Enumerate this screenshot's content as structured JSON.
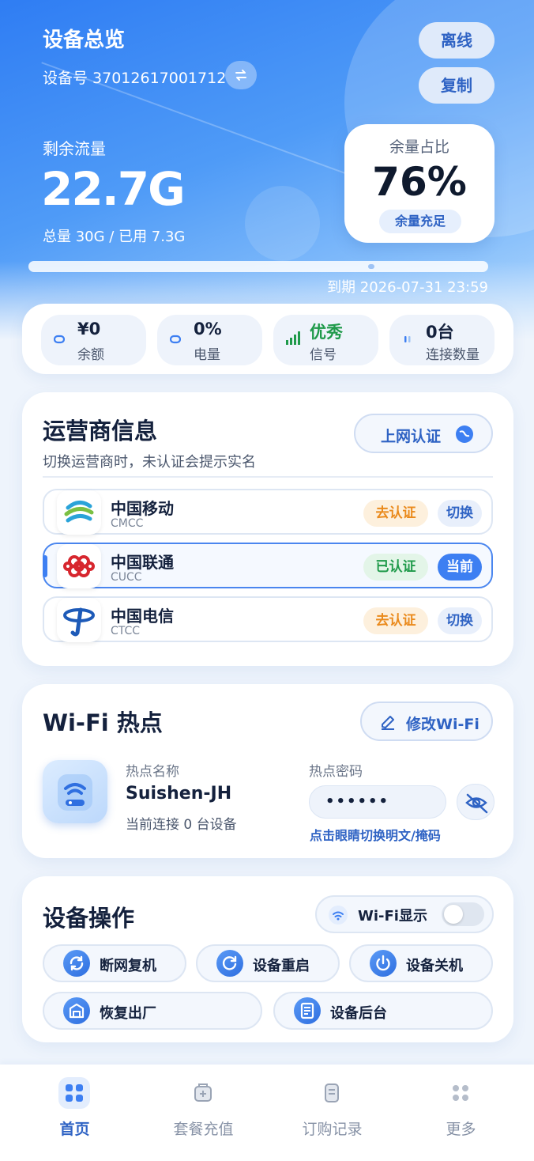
{
  "header": {
    "title": "设备总览",
    "device_no_label": "设备号 37012617001712",
    "offline_label": "离线",
    "copy_label": "复制",
    "remain_label": "剩余流量",
    "remain_value": "22.7G",
    "usage_line": "总量 30G / 已用 7.3G",
    "ratio_label": "余量占比",
    "ratio_value": "76%",
    "ratio_badge": "余量充足",
    "expire_text": "到期 2026-07-31 23:59"
  },
  "stats": [
    {
      "value": "¥0",
      "label": "余额",
      "icon": "balance-icon"
    },
    {
      "value": "0%",
      "label": "电量",
      "icon": "battery-icon"
    },
    {
      "value": "优秀",
      "label": "信号",
      "icon": "signal-icon"
    },
    {
      "value": "0台",
      "label": "连接数量",
      "icon": "connections-icon"
    }
  ],
  "operator": {
    "title": "运营商信息",
    "subtitle": "切换运营商时，未认证会提示实名",
    "auth_button": "上网认证",
    "items": [
      {
        "name": "中国移动",
        "code": "CMCC",
        "status": "去认证",
        "action": "切换"
      },
      {
        "name": "中国联通",
        "code": "CUCC",
        "status": "已认证",
        "action": "当前"
      },
      {
        "name": "中国电信",
        "code": "CTCC",
        "status": "去认证",
        "action": "切换"
      }
    ]
  },
  "wifi": {
    "title": "Wi-Fi 热点",
    "edit_button": "修改Wi-Fi",
    "ssid_label": "热点名称",
    "ssid": "Suishen-JH",
    "connected_text": "当前连接 0 台设备",
    "pwd_label": "热点密码",
    "pwd_masked": "••••••",
    "pwd_hint": "点击眼睛切换明文/掩码"
  },
  "ops": {
    "title": "设备操作",
    "wifi_display_label": "Wi-Fi显示",
    "buttons": [
      "断网复机",
      "设备重启",
      "设备关机",
      "恢复出厂",
      "设备后台"
    ]
  },
  "tabbar": {
    "items": [
      "首页",
      "套餐充值",
      "订购记录",
      "更多"
    ]
  },
  "colors": {
    "accent": "#3d7ff2",
    "hero_start": "#2f7df3",
    "green": "#1f9a4a",
    "orange": "#ea8a1c"
  }
}
